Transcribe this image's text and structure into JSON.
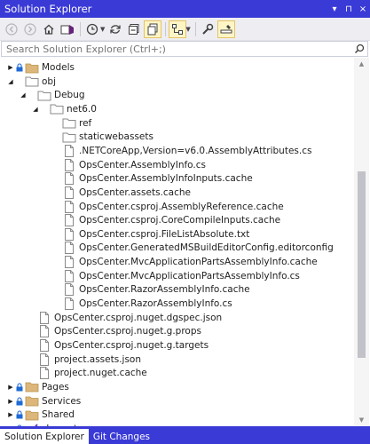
{
  "window": {
    "title": "Solution Explorer",
    "controls": [
      "▾",
      "⊓",
      "×"
    ]
  },
  "search": {
    "placeholder": "Search Solution Explorer (Ctrl+;)"
  },
  "tree": [
    {
      "label": "Models",
      "icon": "folder-icon",
      "expander": "collapsed",
      "locked": true,
      "depth": 0
    },
    {
      "label": "obj",
      "icon": "folder-outline-icon",
      "expander": "expanded",
      "locked": false,
      "depth": 0
    },
    {
      "label": "Debug",
      "icon": "folder-outline-icon",
      "expander": "expanded",
      "locked": false,
      "depth": 1
    },
    {
      "label": "net6.0",
      "icon": "folder-outline-icon",
      "expander": "expanded",
      "locked": false,
      "depth": 2
    },
    {
      "label": "ref",
      "icon": "folder-outline-icon",
      "expander": "none",
      "locked": false,
      "depth": 3
    },
    {
      "label": "staticwebassets",
      "icon": "folder-outline-icon",
      "expander": "none",
      "locked": false,
      "depth": 3
    },
    {
      "label": ".NETCoreApp,Version=v6.0.AssemblyAttributes.cs",
      "icon": "file-icon",
      "expander": "none",
      "locked": false,
      "depth": 3
    },
    {
      "label": "OpsCenter.AssemblyInfo.cs",
      "icon": "file-icon",
      "expander": "none",
      "locked": false,
      "depth": 3
    },
    {
      "label": "OpsCenter.AssemblyInfoInputs.cache",
      "icon": "file-icon",
      "expander": "none",
      "locked": false,
      "depth": 3
    },
    {
      "label": "OpsCenter.assets.cache",
      "icon": "file-icon",
      "expander": "none",
      "locked": false,
      "depth": 3
    },
    {
      "label": "OpsCenter.csproj.AssemblyReference.cache",
      "icon": "file-icon",
      "expander": "none",
      "locked": false,
      "depth": 3
    },
    {
      "label": "OpsCenter.csproj.CoreCompileInputs.cache",
      "icon": "file-icon",
      "expander": "none",
      "locked": false,
      "depth": 3
    },
    {
      "label": "OpsCenter.csproj.FileListAbsolute.txt",
      "icon": "file-icon",
      "expander": "none",
      "locked": false,
      "depth": 3
    },
    {
      "label": "OpsCenter.GeneratedMSBuildEditorConfig.editorconfig",
      "icon": "file-icon",
      "expander": "none",
      "locked": false,
      "depth": 3
    },
    {
      "label": "OpsCenter.MvcApplicationPartsAssemblyInfo.cache",
      "icon": "file-icon",
      "expander": "none",
      "locked": false,
      "depth": 3
    },
    {
      "label": "OpsCenter.MvcApplicationPartsAssemblyInfo.cs",
      "icon": "file-icon",
      "expander": "none",
      "locked": false,
      "depth": 3
    },
    {
      "label": "OpsCenter.RazorAssemblyInfo.cache",
      "icon": "file-icon",
      "expander": "none",
      "locked": false,
      "depth": 3
    },
    {
      "label": "OpsCenter.RazorAssemblyInfo.cs",
      "icon": "file-icon",
      "expander": "none",
      "locked": false,
      "depth": 3
    },
    {
      "label": "OpsCenter.csproj.nuget.dgspec.json",
      "icon": "file-icon",
      "expander": "none",
      "locked": false,
      "depth": 1
    },
    {
      "label": "OpsCenter.csproj.nuget.g.props",
      "icon": "file-icon",
      "expander": "none",
      "locked": false,
      "depth": 1
    },
    {
      "label": "OpsCenter.csproj.nuget.g.targets",
      "icon": "file-icon",
      "expander": "none",
      "locked": false,
      "depth": 1
    },
    {
      "label": "project.assets.json",
      "icon": "file-icon",
      "expander": "none",
      "locked": false,
      "depth": 1
    },
    {
      "label": "project.nuget.cache",
      "icon": "file-icon",
      "expander": "none",
      "locked": false,
      "depth": 1
    },
    {
      "label": "Pages",
      "icon": "folder-icon",
      "expander": "collapsed",
      "locked": true,
      "depth": 0
    },
    {
      "label": "Services",
      "icon": "folder-icon",
      "expander": "collapsed",
      "locked": true,
      "depth": 0
    },
    {
      "label": "Shared",
      "icon": "folder-icon",
      "expander": "collapsed",
      "locked": true,
      "depth": 0
    },
    {
      "label": "_Imports.razor",
      "icon": "razor-file-icon",
      "expander": "none",
      "locked": true,
      "depth": 0
    }
  ],
  "tabs": [
    {
      "label": "Solution Explorer",
      "active": true
    },
    {
      "label": "Git Changes",
      "active": false
    }
  ],
  "colors": {
    "title_bar": "#3a3ad6",
    "folder": "#dcb67a",
    "lock": "#1e6ad6",
    "toolbar_bg": "#eeeef2"
  }
}
